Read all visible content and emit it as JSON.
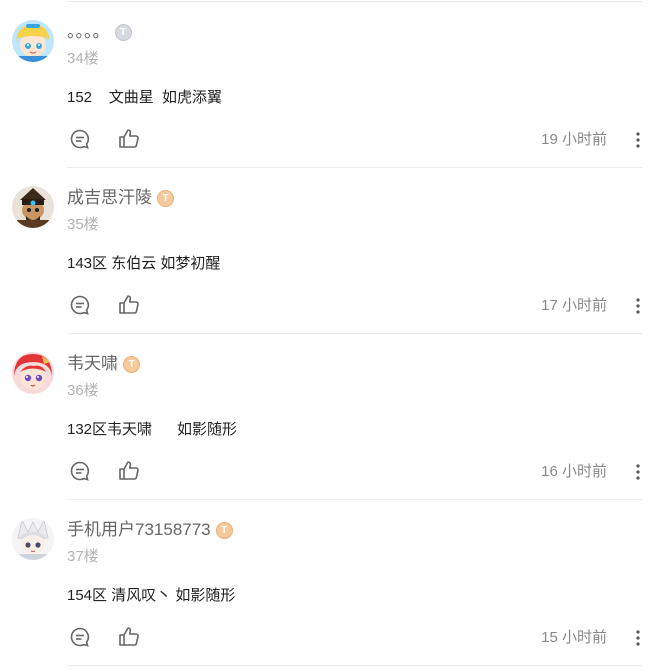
{
  "posts": [
    {
      "username": "。。。。",
      "badge": "grey",
      "floor": "34楼",
      "content": "152    文曲星  如虎添翼",
      "time": "19 小时前"
    },
    {
      "username": "成吉思汗陵",
      "badge": "gold",
      "floor": "35楼",
      "content": "143区 东伯云 如梦初醒",
      "time": "17 小时前"
    },
    {
      "username": "韦天啸",
      "badge": "gold",
      "floor": "36楼",
      "content": "132区韦天啸      如影随形",
      "time": "16 小时前"
    },
    {
      "username": "手机用户73158773",
      "badge": "gold",
      "floor": "37楼",
      "content": "154区 清风叹丶 如影随形",
      "time": "15 小时前"
    }
  ],
  "icons": {
    "reply": "comment-bubble-icon",
    "like": "thumbs-up-icon",
    "more": "more-vertical-icon",
    "badge": "level-badge-icon"
  },
  "colors": {
    "badge_gold": "#f5c99b",
    "badge_grey": "#d6d9e0",
    "username": "#666666",
    "floor": "#b3b3b3",
    "time": "#888888"
  }
}
